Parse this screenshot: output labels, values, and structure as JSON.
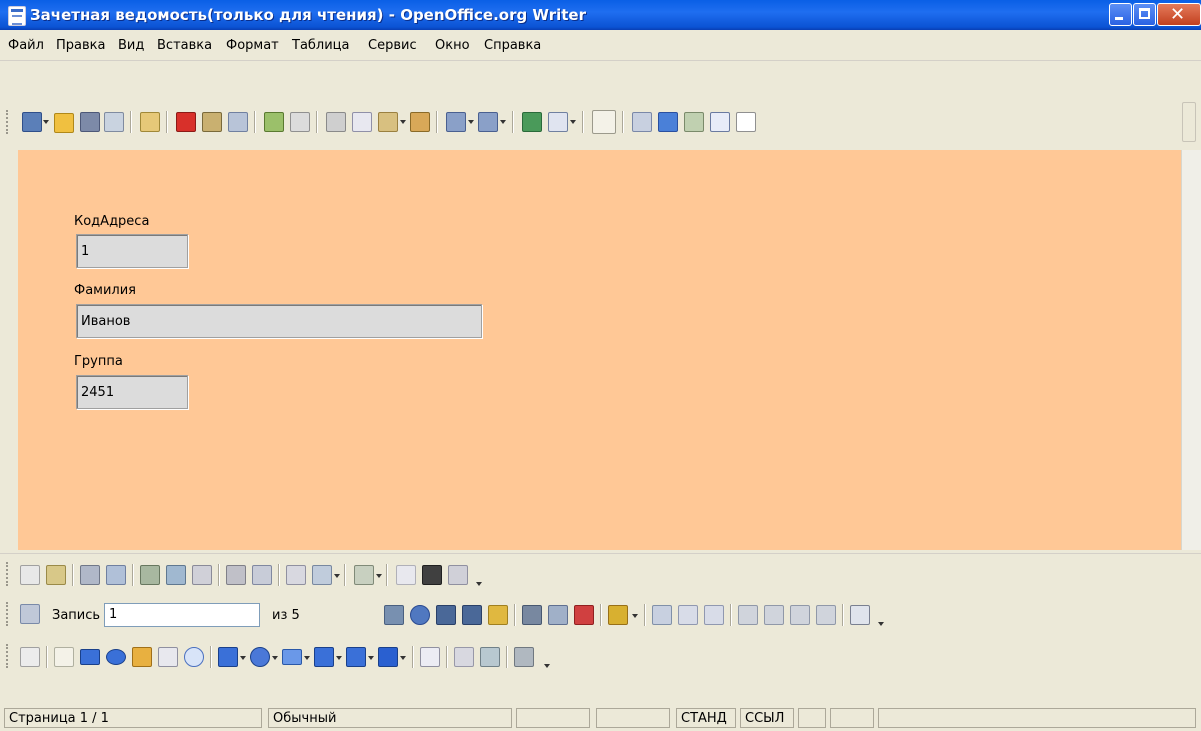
{
  "window": {
    "title": "Зачетная ведомость(только для чтения) - OpenOffice.org Writer"
  },
  "menu": {
    "items": [
      "Файл",
      "Правка",
      "Вид",
      "Вставка",
      "Формат",
      "Таблица",
      "Сервис",
      "Окно",
      "Справка"
    ]
  },
  "form": {
    "fields": [
      {
        "label": "КодАдреса",
        "value": "1"
      },
      {
        "label": "Фамилия",
        "value": "Иванов"
      },
      {
        "label": "Группа",
        "value": "2451"
      }
    ]
  },
  "navigation": {
    "record_label": "Запись",
    "record_value": "1",
    "of_label": "из 5"
  },
  "status": {
    "page": "Страница 1 / 1",
    "style": "Обычный",
    "mode": "СТАНД",
    "ref": "ССЫЛ"
  },
  "colors": {
    "document_background": "#ffc896",
    "titlebar": "#0b53d4"
  }
}
